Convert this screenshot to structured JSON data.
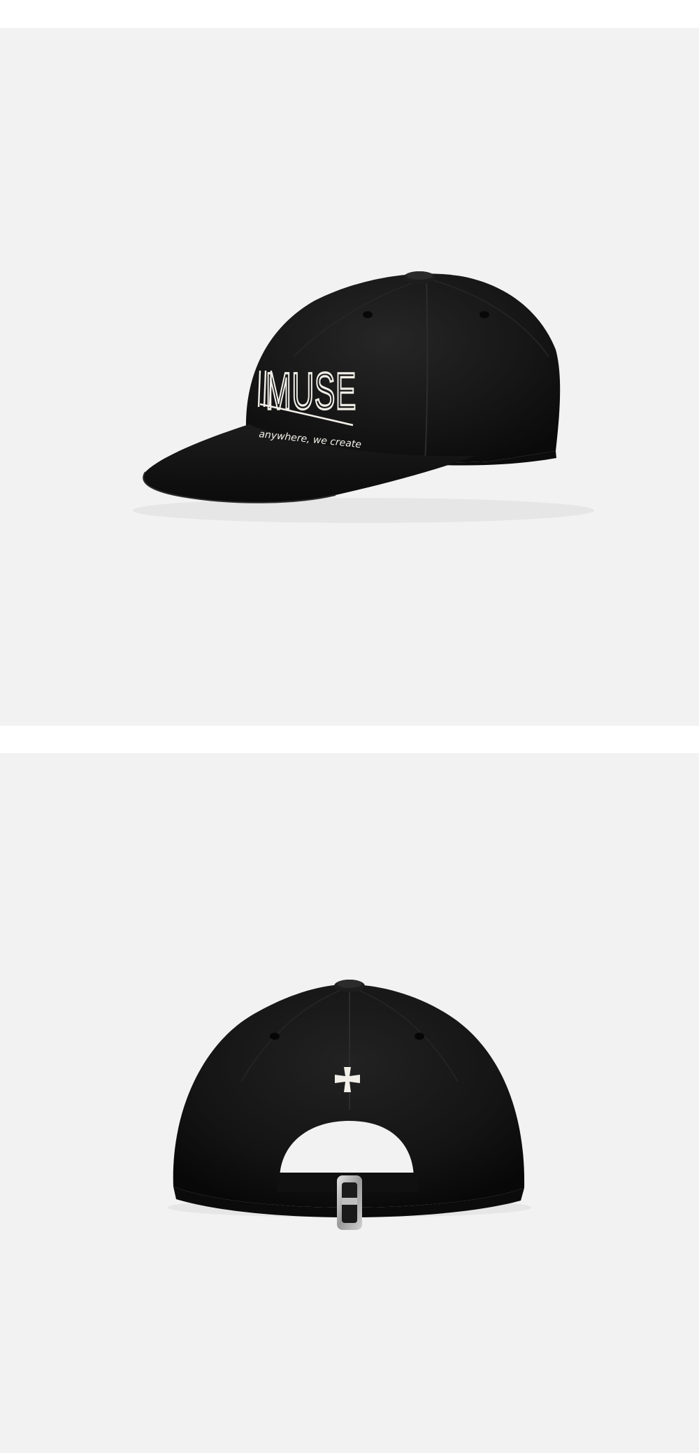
{
  "photos": [
    {
      "view": "front-side",
      "logo_text": "MUSE",
      "tagline": "anywhere, we create"
    },
    {
      "view": "back",
      "emblem": "cross-patee-icon"
    }
  ],
  "colors": {
    "background": "#f2f2f2",
    "gap": "#ffffff",
    "cap": "#121212",
    "embroidery": "#f1efe8",
    "buckle": "#b9b9b9"
  }
}
